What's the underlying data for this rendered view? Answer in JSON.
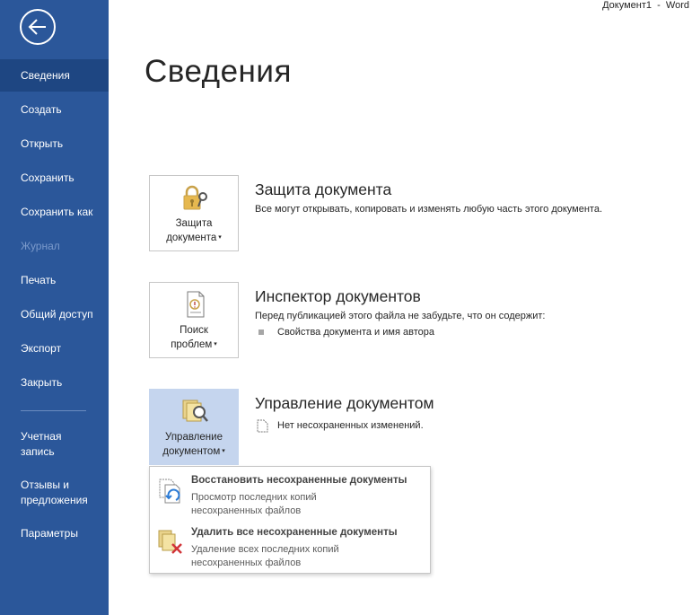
{
  "window": {
    "title": "Документ1  -  Word"
  },
  "sidebar": {
    "items": [
      {
        "label": "Сведения",
        "active": true
      },
      {
        "label": "Создать"
      },
      {
        "label": "Открыть"
      },
      {
        "label": "Сохранить"
      },
      {
        "label": "Сохранить как"
      },
      {
        "label": "Журнал",
        "disabled": true
      },
      {
        "label": "Печать"
      },
      {
        "label": "Общий доступ"
      },
      {
        "label": "Экспорт"
      },
      {
        "label": "Закрыть"
      },
      {
        "label": "Учетная запись"
      },
      {
        "label": "Отзывы и предложения"
      },
      {
        "label": "Параметры"
      }
    ]
  },
  "main": {
    "title": "Сведения",
    "protect": {
      "button_line1": "Защита",
      "button_line2": "документа",
      "heading": "Защита документа",
      "description": "Все могут открывать, копировать и изменять любую часть этого документа."
    },
    "inspect": {
      "button_line1": "Поиск",
      "button_line2": "проблем",
      "heading": "Инспектор документов",
      "description": "Перед публикацией этого файла не забудьте, что он содержит:",
      "bullet": "Свойства документа и имя автора"
    },
    "manage": {
      "button_line1": "Управление",
      "button_line2": "документом",
      "heading": "Управление документом",
      "status": "Нет несохраненных изменений."
    }
  },
  "dropdown": {
    "items": [
      {
        "title": "Восстановить несохраненные документы",
        "description": "Просмотр последних копий несохраненных файлов",
        "icon": "recover-doc-icon"
      },
      {
        "title": "Удалить все несохраненные документы",
        "description": "Удаление всех последних копий несохраненных файлов",
        "icon": "delete-docs-icon"
      }
    ]
  },
  "colors": {
    "sidebar": "#2b579a",
    "sidebar_active": "#1e4682",
    "selected_tile": "#c5d5ee"
  }
}
